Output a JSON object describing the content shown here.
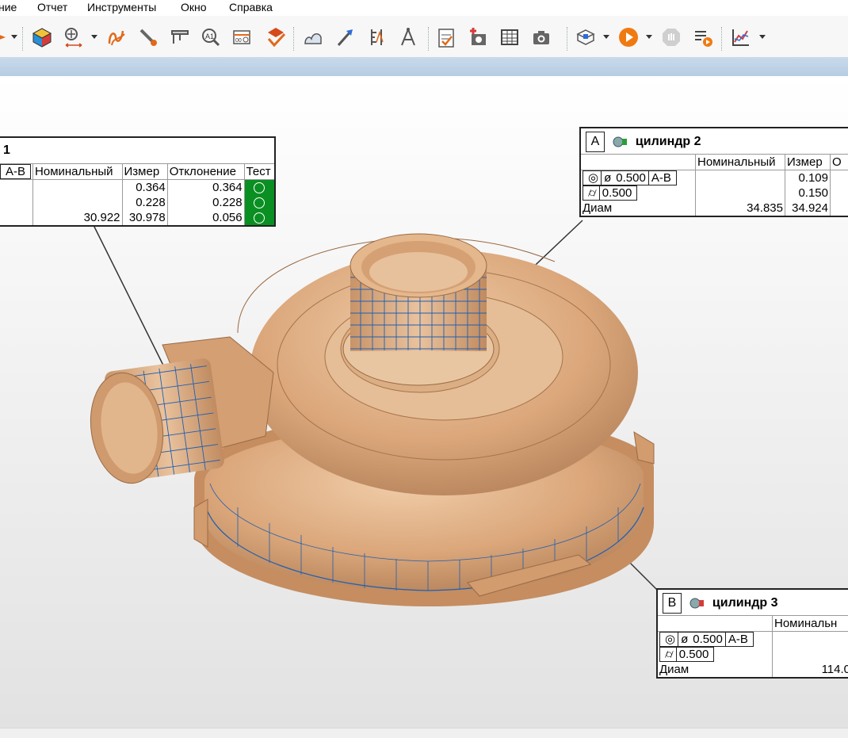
{
  "menu": {
    "items": [
      "ние",
      "Отчет",
      "Инструменты",
      "Окно",
      "Справка"
    ]
  },
  "toolbar": {
    "icons": [
      "cube-icon",
      "mesh-transform-icon",
      "curve-icon",
      "probe-icon",
      "caliper-icon",
      "text-measure-icon",
      "gd-t-icon",
      "check-flag-icon",
      "cloud-profile-icon",
      "flag-scale-icon",
      "gauge-icon",
      "compass-icon",
      "checklist-icon",
      "add-photo-icon",
      "table-icon",
      "camera-icon",
      "report-settings-icon",
      "play-icon",
      "stop-icon",
      "list-play-icon",
      "chart-icon"
    ]
  },
  "callout_left": {
    "title": "1",
    "headers": [
      "Номинальный",
      "Измер",
      "Отклонение",
      "Тест"
    ],
    "datum": "A-B",
    "rows": [
      {
        "nominal": "",
        "measured": "0.364",
        "deviation": "0.364"
      },
      {
        "nominal": "",
        "measured": "0.228",
        "deviation": "0.228"
      },
      {
        "nominal": "30.922",
        "measured": "30.978",
        "deviation": "0.056"
      }
    ]
  },
  "callout_a": {
    "letter": "A",
    "title": "цилиндр 2",
    "headers": [
      "Номинальный",
      "Измер",
      "О"
    ],
    "fcf1": {
      "symbol": "◎",
      "dia": "ø",
      "tol": "0.500",
      "datum": "A-B"
    },
    "fcf2": {
      "symbol": "⌭",
      "tol": "0.500"
    },
    "diam_label": "Диам",
    "rows": [
      {
        "nominal": "",
        "measured": "0.109"
      },
      {
        "nominal": "",
        "measured": "0.150"
      },
      {
        "nominal": "34.835",
        "measured": "34.924"
      }
    ]
  },
  "callout_b": {
    "letter": "B",
    "title": "цилиндр 3",
    "headers": [
      "Номинальн"
    ],
    "fcf1": {
      "symbol": "◎",
      "dia": "ø",
      "tol": "0.500",
      "datum": "A-B"
    },
    "fcf2": {
      "symbol": "⌭",
      "tol": "0.500"
    },
    "diam_label": "Диам",
    "rows": [
      {
        "nominal": ""
      },
      {
        "nominal": ""
      },
      {
        "nominal": "114.0"
      }
    ]
  },
  "colors": {
    "part": "#dcaa82",
    "mesh": "#1f5fb0",
    "pass": "#0a8f22"
  }
}
